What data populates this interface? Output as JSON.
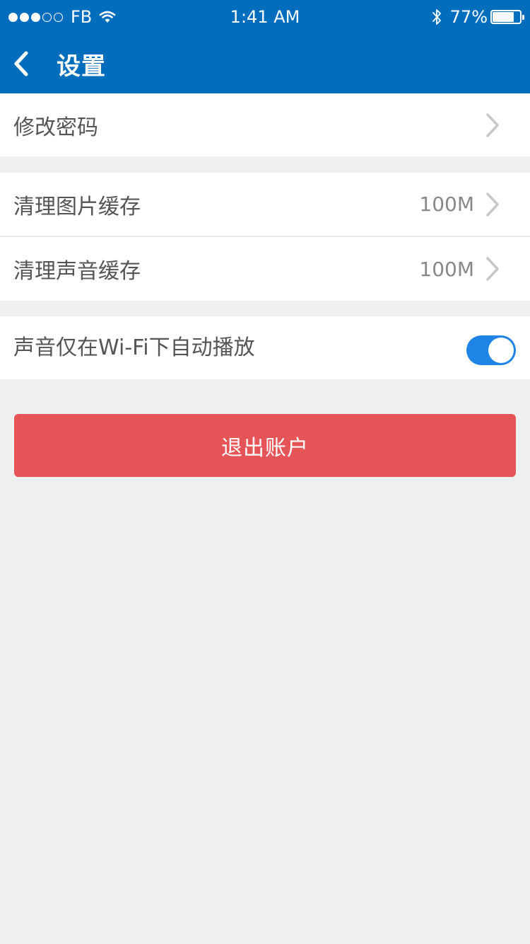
{
  "status_bar": {
    "carrier": "FB",
    "time": "1:41 AM",
    "battery": "77%",
    "signal_dots_filled": 3,
    "signal_dots_total": 5
  },
  "header": {
    "title": "设置",
    "back_icon": "chevron-left-icon",
    "color": "#006dbd"
  },
  "rows": {
    "change_password": {
      "label": "修改密码",
      "icon": "chevron-right-icon"
    },
    "clear_image_cache": {
      "label": "清理图片缓存",
      "value": "100M",
      "icon": "chevron-right-icon"
    },
    "clear_audio_cache": {
      "label": "清理声音缓存",
      "value": "100M",
      "icon": "chevron-right-icon"
    },
    "wifi_autoplay": {
      "label": "声音仅在Wi-Fi下自动播放",
      "enabled": true,
      "toggle_color": "#1e84e6"
    }
  },
  "logout": {
    "label": "退出账户",
    "color": "#e55558"
  }
}
